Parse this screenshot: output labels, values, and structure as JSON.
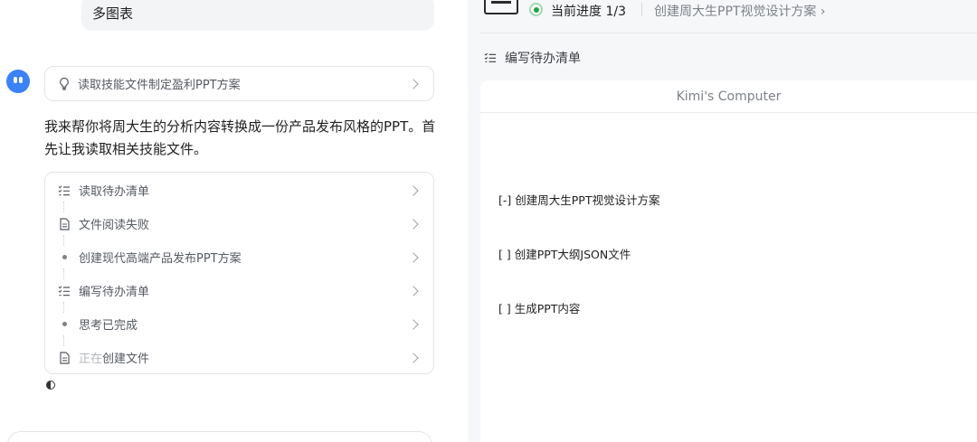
{
  "chat": {
    "user_bubble_text": "多图表",
    "skill_card_label": "读取技能文件制定盈利PPT方案",
    "assistant_message": "我来帮你将周大生的分析内容转换成一份产品发布风格的PPT。首先让我读取相关技能文件。",
    "steps": [
      {
        "label": "读取待办清单",
        "icon": "checklist-icon"
      },
      {
        "label": "文件阅读失败",
        "icon": "document-icon"
      },
      {
        "label": "创建现代高端产品发布PPT方案",
        "icon": "bullet-dot-icon"
      },
      {
        "label": "编写待办清单",
        "icon": "checklist-icon"
      },
      {
        "label": "思考已完成",
        "icon": "bullet-dot-icon"
      },
      {
        "label_dim": "正在",
        "label_tail": "创建文件",
        "icon": "document-icon"
      }
    ]
  },
  "computer": {
    "progress_label": "当前进度 1/3",
    "task_title": "创建周大生PPT视觉设计方案 ›",
    "todo_header": "编写待办清单",
    "window_title": "Kimi's Computer",
    "todo_lines": [
      "[-] 创建周大生PPT视觉设计方案",
      "[ ] 创建PPT大纲JSON文件",
      "[ ] 生成PPT内容"
    ]
  },
  "colors": {
    "accent_blue": "#3b82f6",
    "status_green": "#22a447",
    "panel_bg": "#f6f7f9",
    "border": "#e3e5e8"
  }
}
